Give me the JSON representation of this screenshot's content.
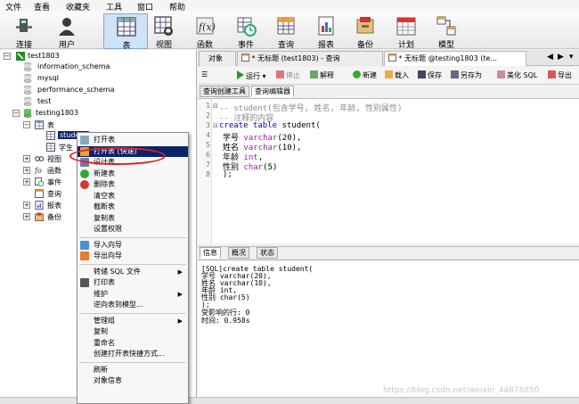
{
  "menubar": [
    "文件",
    "查看",
    "收藏夹",
    "工具",
    "窗口",
    "帮助"
  ],
  "toolbar": {
    "buttons": [
      {
        "label": "连接",
        "icon": "connect-icon"
      },
      {
        "label": "用户",
        "icon": "user-icon"
      },
      {
        "label": "表",
        "icon": "table-icon",
        "active": true
      },
      {
        "label": "视图",
        "icon": "view-icon"
      },
      {
        "label": "函数",
        "icon": "function-icon"
      },
      {
        "label": "事件",
        "icon": "event-icon"
      },
      {
        "label": "查询",
        "icon": "query-icon"
      },
      {
        "label": "报表",
        "icon": "report-icon"
      },
      {
        "label": "备份",
        "icon": "backup-icon"
      },
      {
        "label": "计划",
        "icon": "schedule-icon"
      },
      {
        "label": "模型",
        "icon": "model-icon"
      }
    ]
  },
  "tree": {
    "connection": "test1803",
    "databases": [
      "information_schema",
      "mysql",
      "performance_schema",
      "test"
    ],
    "open_db": "testing1803",
    "tables_node": "表",
    "tables": [
      "student",
      "学生"
    ],
    "other_nodes": [
      "视图",
      "函数",
      "事件",
      "查询",
      "报表",
      "备份"
    ]
  },
  "tabs": {
    "objects": "对象",
    "tab1": "* 无标题 (test1803) - 查询",
    "tab2": "* 无标题 @testing1803 (te..."
  },
  "query_toolbar": {
    "run": "运行",
    "stop": "停止",
    "explain": "解释",
    "new": "新建",
    "load": "载入",
    "save": "保存",
    "save_as": "另存为",
    "beautify": "美化 SQL",
    "export": "导出"
  },
  "subtabs": [
    "查询创建工具",
    "查询编辑器"
  ],
  "editor": {
    "lines": [
      {
        "n": "1",
        "fold": "-",
        "parts": [
          {
            "t": "-- student(包含学号, 姓名, 年龄, 性别属性)",
            "c": "cm"
          }
        ]
      },
      {
        "n": "2",
        "fold": "",
        "parts": [
          {
            "t": "-- 注释的内容",
            "c": "cm"
          }
        ]
      },
      {
        "n": "3",
        "fold": "-",
        "parts": [
          {
            "t": "create table ",
            "c": "kw"
          },
          {
            "t": "student(",
            "c": ""
          }
        ]
      },
      {
        "n": "4",
        "fold": "",
        "parts": [
          {
            "t": "学号 ",
            "c": ""
          },
          {
            "t": "varchar",
            "c": "ty"
          },
          {
            "t": "(20),",
            "c": ""
          }
        ]
      },
      {
        "n": "5",
        "fold": "",
        "parts": [
          {
            "t": "姓名 ",
            "c": ""
          },
          {
            "t": "varchar",
            "c": "ty"
          },
          {
            "t": "(10),",
            "c": ""
          }
        ]
      },
      {
        "n": "6",
        "fold": "",
        "parts": [
          {
            "t": "年龄 ",
            "c": ""
          },
          {
            "t": "int",
            "c": "ty"
          },
          {
            "t": ",",
            "c": ""
          }
        ]
      },
      {
        "n": "7",
        "fold": "",
        "parts": [
          {
            "t": "性别 ",
            "c": ""
          },
          {
            "t": "char",
            "c": "ty"
          },
          {
            "t": "(5)",
            "c": ""
          }
        ]
      },
      {
        "n": "8",
        "fold": "",
        "parts": [
          {
            "t": ");",
            "c": ""
          }
        ]
      }
    ]
  },
  "info_tabs": [
    "信息",
    "概况",
    "状态"
  ],
  "info_lines": [
    "[SQL]create table student(",
    "学号 varchar(20),",
    "姓名 varchar(10),",
    "年龄 int,",
    "性别 char(5)",
    ");",
    "受影响的行: 0",
    "时间: 0.958s"
  ],
  "context_menu": [
    {
      "label": "打开表",
      "icon": "open-table-icon"
    },
    {
      "label": "打开表 (快速)",
      "icon": "open-table-fast-icon",
      "highlight": true
    },
    {
      "label": "设计表",
      "icon": "design-table-icon"
    },
    {
      "label": "新建表",
      "icon": "new-table-icon"
    },
    {
      "label": "删除表",
      "icon": "delete-table-icon"
    },
    {
      "label": "清空表"
    },
    {
      "label": "截断表"
    },
    {
      "label": "复制表"
    },
    {
      "label": "设置权限"
    },
    {
      "sep": true
    },
    {
      "label": "导入向导",
      "icon": "import-wizard-icon"
    },
    {
      "label": "导出向导",
      "icon": "export-wizard-icon"
    },
    {
      "sep": true
    },
    {
      "label": "转储 SQL 文件",
      "submenu": true
    },
    {
      "label": "打印表",
      "icon": "print-icon"
    },
    {
      "label": "维护",
      "submenu": true
    },
    {
      "label": "逆向表到模型..."
    },
    {
      "sep": true
    },
    {
      "label": "管理组",
      "submenu": true
    },
    {
      "label": "复制"
    },
    {
      "label": "重命名"
    },
    {
      "label": "创建打开表快捷方式..."
    },
    {
      "sep": true
    },
    {
      "label": "刷新"
    },
    {
      "label": "对象信息"
    }
  ],
  "watermark": "https://blog.csdn.net/weixin_44878850",
  "colors": {
    "selection": "#0a246a",
    "keyword": "#0000c0",
    "type": "#a01ab0",
    "comment": "#8a8a8a",
    "annotation": "#e02020"
  }
}
